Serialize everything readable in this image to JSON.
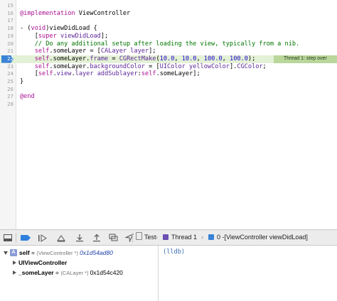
{
  "editor": {
    "lines": [
      {
        "num": "15",
        "code": []
      },
      {
        "num": "16",
        "code": [
          {
            "t": "@implementation",
            "c": "kw-at"
          },
          {
            "t": " ViewController",
            "c": ""
          }
        ]
      },
      {
        "num": "17",
        "code": []
      },
      {
        "num": "18",
        "code": [
          {
            "t": "- (",
            "c": ""
          },
          {
            "t": "void",
            "c": "kw"
          },
          {
            "t": ")viewDidLoad {",
            "c": ""
          }
        ]
      },
      {
        "num": "19",
        "code": [
          {
            "t": "    [",
            "c": ""
          },
          {
            "t": "super",
            "c": "kw"
          },
          {
            "t": " ",
            "c": ""
          },
          {
            "t": "viewDidLoad",
            "c": "ty"
          },
          {
            "t": "];",
            "c": ""
          }
        ]
      },
      {
        "num": "20",
        "code": [
          {
            "t": "    // Do any additional setup after loading the view, typically from a nib.",
            "c": "cm"
          }
        ]
      },
      {
        "num": "21",
        "code": [
          {
            "t": "    ",
            "c": ""
          },
          {
            "t": "self",
            "c": "sf"
          },
          {
            "t": ".someLayer = [",
            "c": ""
          },
          {
            "t": "CALayer",
            "c": "ty"
          },
          {
            "t": " ",
            "c": ""
          },
          {
            "t": "layer",
            "c": "ty"
          },
          {
            "t": "];",
            "c": ""
          }
        ]
      },
      {
        "num": "22",
        "code": [
          {
            "t": "    ",
            "c": ""
          },
          {
            "t": "self",
            "c": "sf"
          },
          {
            "t": ".someLayer.",
            "c": ""
          },
          {
            "t": "frame",
            "c": "ty"
          },
          {
            "t": " = ",
            "c": ""
          },
          {
            "t": "CGRectMake",
            "c": "ty"
          },
          {
            "t": "(",
            "c": ""
          },
          {
            "t": "10.0",
            "c": "num"
          },
          {
            "t": ", ",
            "c": ""
          },
          {
            "t": "10.0",
            "c": "num"
          },
          {
            "t": ", ",
            "c": ""
          },
          {
            "t": "100.0",
            "c": "num"
          },
          {
            "t": ", ",
            "c": ""
          },
          {
            "t": "100.0",
            "c": "num"
          },
          {
            "t": ");",
            "c": ""
          }
        ]
      },
      {
        "num": "23",
        "code": [
          {
            "t": "    ",
            "c": ""
          },
          {
            "t": "self",
            "c": "sf"
          },
          {
            "t": ".someLayer.",
            "c": ""
          },
          {
            "t": "backgroundColor",
            "c": "ty"
          },
          {
            "t": " = [",
            "c": ""
          },
          {
            "t": "UIColor",
            "c": "ty"
          },
          {
            "t": " ",
            "c": ""
          },
          {
            "t": "yellowColor",
            "c": "ty"
          },
          {
            "t": "].",
            "c": ""
          },
          {
            "t": "CGColor",
            "c": "ty"
          },
          {
            "t": ";",
            "c": ""
          }
        ]
      },
      {
        "num": "24",
        "code": [
          {
            "t": "    [",
            "c": ""
          },
          {
            "t": "self",
            "c": "sf"
          },
          {
            "t": ".",
            "c": ""
          },
          {
            "t": "view",
            "c": "ty"
          },
          {
            "t": ".",
            "c": ""
          },
          {
            "t": "layer",
            "c": "ty"
          },
          {
            "t": " ",
            "c": ""
          },
          {
            "t": "addSublayer",
            "c": "ty"
          },
          {
            "t": ":",
            "c": ""
          },
          {
            "t": "self",
            "c": "sf"
          },
          {
            "t": ".someLayer];",
            "c": ""
          }
        ]
      },
      {
        "num": "25",
        "code": [
          {
            "t": "}",
            "c": ""
          }
        ]
      },
      {
        "num": "26",
        "code": []
      },
      {
        "num": "27",
        "code": [
          {
            "t": "@end",
            "c": "kw-at"
          }
        ]
      },
      {
        "num": "28",
        "code": []
      }
    ],
    "current_line": "22",
    "thread_badge": "Thread 1: step over",
    "colors": {
      "highlight": "#e3f1d6",
      "pc_arrow": "#3a82d6",
      "badge": "#b9d69b"
    }
  },
  "debug_bar": {
    "buttons": [
      {
        "name": "hide-debug-area-button",
        "icon": "panel-icon"
      },
      {
        "name": "toggle-breakpoints-button",
        "icon": "breakpoint-icon"
      },
      {
        "name": "continue-button",
        "icon": "continue-icon"
      },
      {
        "name": "step-over-button",
        "icon": "step-over-icon"
      },
      {
        "name": "step-into-button",
        "icon": "step-into-icon"
      },
      {
        "name": "step-out-button",
        "icon": "step-out-icon"
      },
      {
        "name": "debug-view-hierarchy-button",
        "icon": "view-hierarchy-icon"
      },
      {
        "name": "simulate-location-button",
        "icon": "location-icon"
      }
    ],
    "breadcrumbs": {
      "app": "Test",
      "thread": "Thread 1",
      "frame_num": "0",
      "frame": "-[ViewController viewDidLoad]"
    }
  },
  "variables": {
    "rows": [
      {
        "name": "self",
        "eq": " = ",
        "type": "(ViewController *)",
        "value": "0x1d54ad80",
        "disclosure": "down",
        "badge": "A",
        "indent": 0
      },
      {
        "name": "UIViewController",
        "eq": "",
        "type": "",
        "value": "",
        "disclosure": "right",
        "badge": "",
        "indent": 1
      },
      {
        "name": "_someLayer",
        "eq": " = ",
        "type": "(CALayer *)",
        "value": "0x1d54c420",
        "disclosure": "right",
        "badge": "",
        "indent": 1
      }
    ]
  },
  "console": {
    "prompt": "(lldb)"
  }
}
